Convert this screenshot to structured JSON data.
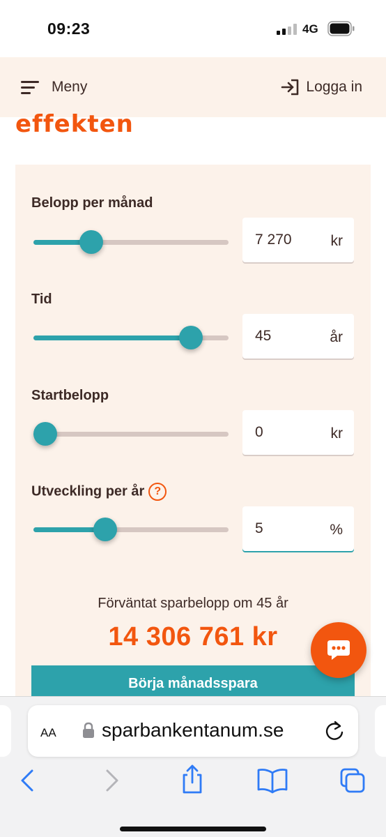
{
  "status_bar": {
    "time": "09:23",
    "network": "4G"
  },
  "header": {
    "menu_label": "Meny",
    "login_label": "Logga in"
  },
  "hero": {
    "word": "effekten"
  },
  "calculator": {
    "fields": [
      {
        "label": "Belopp per månad",
        "value": "7 270",
        "unit": "kr",
        "slider_fraction": 0.27
      },
      {
        "label": "Tid",
        "value": "45",
        "unit": "år",
        "slider_fraction": 0.85
      },
      {
        "label": "Startbelopp",
        "value": "0",
        "unit": "kr",
        "slider_fraction": 0.0
      },
      {
        "label": "Utveckling per år",
        "value": "5",
        "unit": "%",
        "slider_fraction": 0.35,
        "help": "?"
      }
    ],
    "result_caption": "Förväntat sparbelopp om 45 år",
    "result_value": "14 306 761 kr",
    "cta_label": "Börja månadsspara"
  },
  "browser": {
    "text_size_label": "AA",
    "url": "sparbankentanum.se"
  },
  "icons": {
    "menu": "menu-icon",
    "login": "login-icon",
    "help": "help-icon",
    "chat": "chat-icon",
    "lock": "lock-icon",
    "reload": "reload-icon",
    "back": "back-icon",
    "forward": "forward-icon",
    "share": "share-icon",
    "bookmarks": "bookmarks-icon",
    "tabs": "tabs-icon"
  },
  "colors": {
    "brand_orange": "#f2560f",
    "teal": "#2da2ab",
    "cream_bg": "#fcf2ea",
    "text_dark": "#3d2a26",
    "track": "#d6c7c2",
    "ios_blue": "#2f7bf6"
  }
}
